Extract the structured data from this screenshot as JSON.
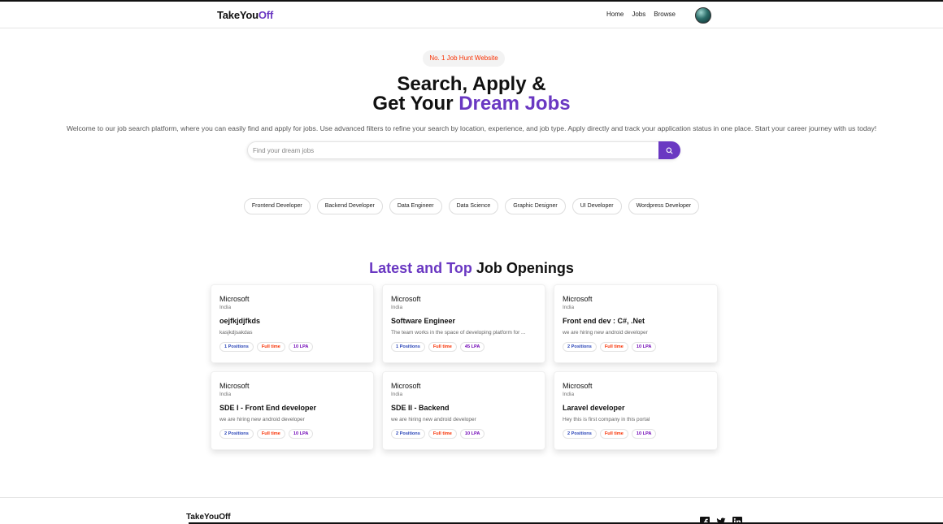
{
  "navbar": {
    "logo_main": "TakeYou",
    "logo_accent": "Off",
    "links": [
      "Home",
      "Jobs",
      "Browse"
    ]
  },
  "hero": {
    "badge": "No. 1 Job Hunt Website",
    "title_line1": "Search, Apply &",
    "title_line2_plain": "Get Your ",
    "title_line2_accent": "Dream Jobs",
    "description": "Welcome to our job search platform, where you can easily find and apply for jobs. Use advanced filters to refine your search by location, experience, and job type. Apply directly and track your application status in one place. Start your career journey with us today!",
    "search_placeholder": "Find your dream jobs",
    "search_value": ""
  },
  "categories": [
    "Frontend Developer",
    "Backend Developer",
    "Data Engineer",
    "Data Science",
    "Graphic Designer",
    "UI Developer",
    "Wordpress Developer"
  ],
  "section": {
    "title_accent": "Latest and Top ",
    "title_plain": "Job Openings"
  },
  "jobs": [
    {
      "company": "Microsoft",
      "location": "India",
      "title": "oejfkjdjfkds",
      "description": "kasjkdjsakdas",
      "positions": "1 Positions",
      "type": "Full time",
      "salary": "10 LPA"
    },
    {
      "company": "Microsoft",
      "location": "India",
      "title": "Software Engineer",
      "description": "The team works in the space of developing platform for ...",
      "positions": "1 Positions",
      "type": "Full time",
      "salary": "45 LPA"
    },
    {
      "company": "Microsoft",
      "location": "India",
      "title": "Front end dev : C#, .Net",
      "description": "we are hiring new android developer",
      "positions": "2 Positions",
      "type": "Full time",
      "salary": "10 LPA"
    },
    {
      "company": "Microsoft",
      "location": "India",
      "title": "SDE I - Front End developer",
      "description": "we are hiring new android developer",
      "positions": "2 Positions",
      "type": "Full time",
      "salary": "10 LPA"
    },
    {
      "company": "Microsoft",
      "location": "India",
      "title": "SDE II - Backend",
      "description": "we are hiring new android developer",
      "positions": "2 Positions",
      "type": "Full time",
      "salary": "10 LPA"
    },
    {
      "company": "Microsoft",
      "location": "India",
      "title": "Laravel developer",
      "description": "Hey this is first company in this portal",
      "positions": "2 Positions",
      "type": "Full time",
      "salary": "10 LPA"
    }
  ],
  "footer": {
    "logo": "TakeYouOff",
    "socials": [
      "facebook-icon",
      "twitter-icon",
      "linkedin-icon"
    ]
  },
  "colors": {
    "accent": "#6a38c2",
    "badge_text": "#f83002",
    "positions_tag": "#2b46b8",
    "type_tag": "#f83002",
    "salary_tag": "#7209b7"
  }
}
